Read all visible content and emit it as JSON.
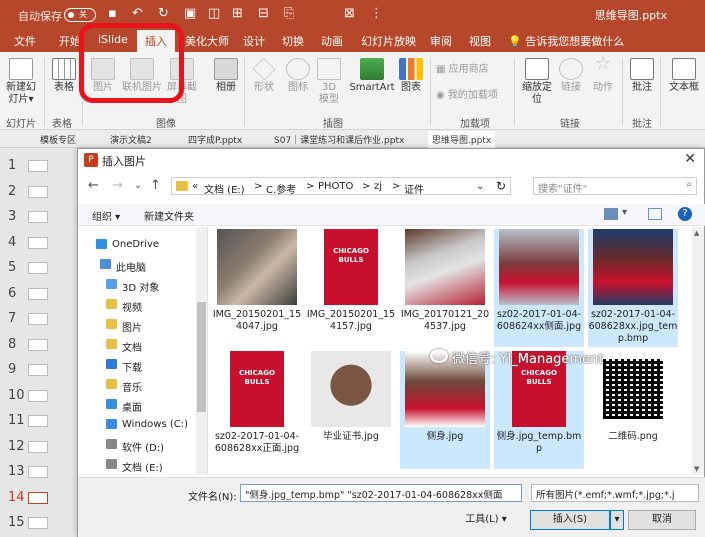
{
  "titlebar": {
    "autosave": "自动保存",
    "toggle": "关",
    "document": "思维导图.pptx"
  },
  "tabs": [
    "文件",
    "开始",
    "iSlide",
    "插入",
    "美化大师",
    "设计",
    "切换",
    "动画",
    "幻灯片放映",
    "审阅",
    "视图"
  ],
  "active_tab": "插入",
  "tellme": "告诉我您想要做什么",
  "ribbon": {
    "new_slide": "新建幻灯片",
    "new_slide_arrow": "▾",
    "table": "表格",
    "picture": "图片",
    "online_picture": "联机图片",
    "screenshot": "屏幕截图",
    "album": "相册",
    "shapes": "形状",
    "icons": "图标",
    "model3d": "3D 模型",
    "smartart": "SmartArt",
    "chart": "图表",
    "app_store": "应用商店",
    "my_addins": "我的加载项",
    "zoom": "缩放定位",
    "link": "链接",
    "action": "动作",
    "comment": "批注",
    "textbox": "文本框",
    "groups": {
      "slides": "幻灯片",
      "tables": "表格",
      "images": "图像",
      "illustrations": "插图",
      "addins": "加载项",
      "links": "链接",
      "comments": "批注"
    }
  },
  "doc_tabs": [
    "模板专区",
    "演示文稿2",
    "四字成P.pptx",
    "S07｜课堂练习和课后作业.pptx",
    "思维导图.pptx"
  ],
  "slides": [
    "1",
    "2",
    "3",
    "4",
    "5",
    "6",
    "7",
    "8",
    "9",
    "10",
    "11",
    "12",
    "13",
    "14",
    "15"
  ],
  "current_slide": "14",
  "dialog": {
    "title": "插入图片",
    "close": "✕",
    "nav": {
      "back": "←",
      "forward": "→",
      "down": "⌄",
      "up": "↑"
    },
    "address": [
      "«",
      "文档 (E:)",
      ">",
      "C.参考",
      ">",
      "PHOTO",
      ">",
      "zj",
      ">",
      "证件"
    ],
    "address_dropdown": "⌄",
    "refresh": "↻",
    "search_placeholder": "搜索\"证件\"",
    "organize": "组织 ▾",
    "new_folder": "新建文件夹",
    "help": "?",
    "tree": [
      {
        "label": "OneDrive",
        "icon": "cloud-icon",
        "color": "#2e8fe0"
      },
      {
        "label": "此电脑",
        "icon": "computer-icon",
        "color": "#4a90d9"
      },
      {
        "label": "3D 对象",
        "icon": "folder-3d-icon",
        "color": "#5aa0e8"
      },
      {
        "label": "视频",
        "icon": "folder-video-icon",
        "color": "#e8c048"
      },
      {
        "label": "图片",
        "icon": "folder-pictures-icon",
        "color": "#e8c048"
      },
      {
        "label": "文档",
        "icon": "folder-documents-icon",
        "color": "#e8c048"
      },
      {
        "label": "下载",
        "icon": "folder-downloads-icon",
        "color": "#2e7bd6"
      },
      {
        "label": "音乐",
        "icon": "folder-music-icon",
        "color": "#e8c048"
      },
      {
        "label": "桌面",
        "icon": "folder-desktop-icon",
        "color": "#3a8ee0"
      },
      {
        "label": "Windows (C:)",
        "icon": "drive-c-icon",
        "color": "#3a8ee0"
      },
      {
        "label": "软件 (D:)",
        "icon": "drive-d-icon",
        "color": "#888888"
      },
      {
        "label": "文档 (E:)",
        "icon": "drive-e-icon",
        "color": "#888888"
      }
    ],
    "files": [
      {
        "name": "IMG_20150201_154047.jpg",
        "kind": "photo-coach",
        "selected": false
      },
      {
        "name": "IMG_20150201_154157.jpg",
        "kind": "bulls",
        "selected": false
      },
      {
        "name": "IMG_20170121_204537.jpg",
        "kind": "photo-jordan",
        "selected": false
      },
      {
        "name": "sz02-2017-01-04-608624xx侧面.jpg",
        "kind": "photo-player",
        "selected": true
      },
      {
        "name": "sz02-2017-01-04-608628xx.jpg_temp.bmp",
        "kind": "photo-player2",
        "selected": true
      },
      {
        "name": "sz02-2017-01-04-608628xx正面.jpg",
        "kind": "bulls",
        "selected": false
      },
      {
        "name": "毕业证书.jpg",
        "kind": "photo-face",
        "selected": false
      },
      {
        "name": "侧身.jpg",
        "kind": "photo-rodman",
        "selected": true
      },
      {
        "name": "侧身.jpg_temp.bmp",
        "kind": "bulls",
        "selected": true
      },
      {
        "name": "二维码.png",
        "kind": "qr",
        "selected": false
      }
    ],
    "bulls_text": "CHICAGO\nBULLS",
    "filename_label": "文件名(N):",
    "filename_value": "\"侧身.jpg_temp.bmp\" \"sz02-2017-01-04-608628xx侧面",
    "filter_value": "所有图片(*.emf;*.wmf;*.jpg;*.j",
    "tools": "工具(L)",
    "insert": "插入(S)",
    "cancel": "取消"
  },
  "watermark": "微信号: YI_Management",
  "colors": {
    "accent": "#b7472a",
    "highlight": "#e8131b",
    "selection": "#cce8ff"
  }
}
